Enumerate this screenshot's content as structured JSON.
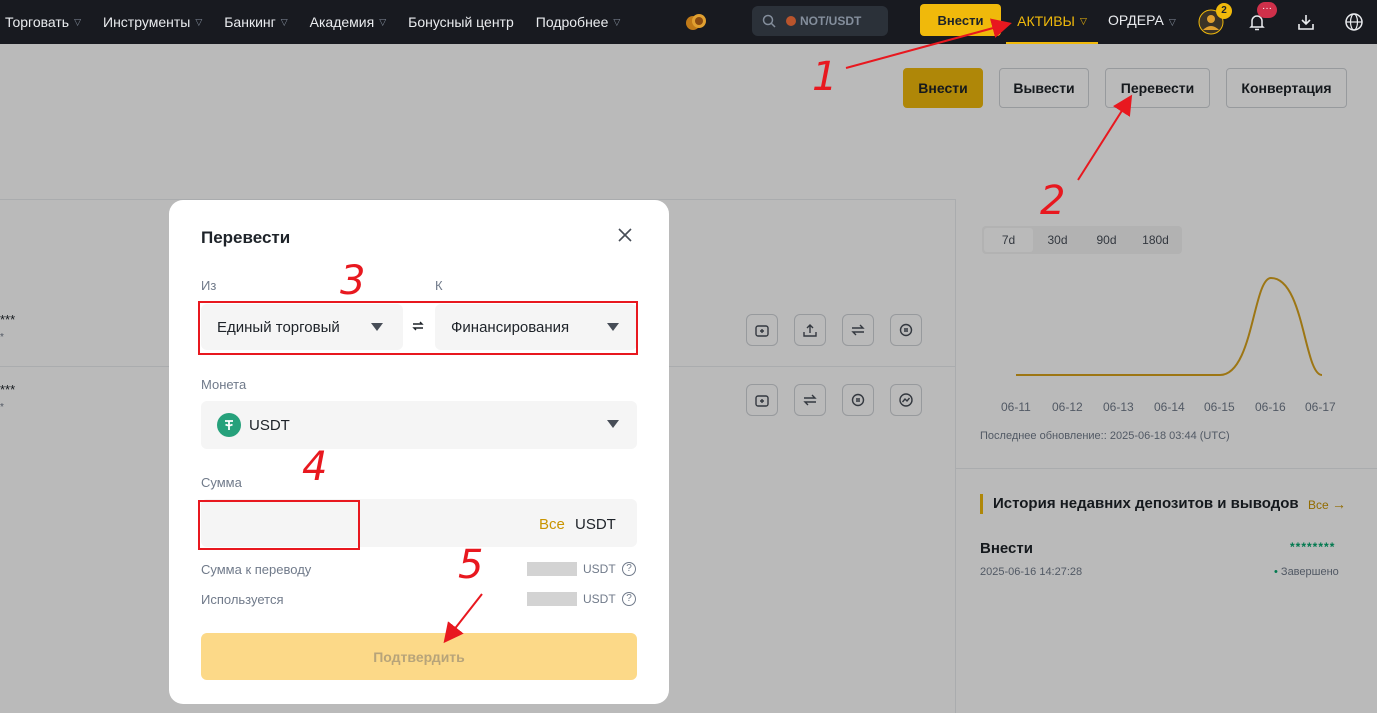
{
  "nav": {
    "items": [
      {
        "label": "Торговать",
        "chevron": true
      },
      {
        "label": "Инструменты",
        "chevron": true
      },
      {
        "label": "Банкинг",
        "chevron": true
      },
      {
        "label": "Академия",
        "chevron": true
      },
      {
        "label": "Бонусный центр",
        "chevron": false
      },
      {
        "label": "Подробнее",
        "chevron": true
      }
    ],
    "search_text": "NOT/USDT",
    "deposit_label": "Внести",
    "assets_label": "АКТИВЫ",
    "orders_label": "ОРДЕРА",
    "avatar_badge": "2",
    "notif_badge": "···"
  },
  "page": {
    "buttons": {
      "deposit": "Внести",
      "withdraw": "Вывести",
      "transfer": "Перевести",
      "convert": "Конвертация"
    },
    "rows": [
      {
        "stars": "***",
        "sub": "*"
      },
      {
        "stars": "***",
        "sub": "*"
      }
    ],
    "period_tabs": [
      "7d",
      "30d",
      "90d",
      "180d"
    ],
    "chart_ticks": [
      "06-11",
      "06-12",
      "06-13",
      "06-14",
      "06-15",
      "06-16",
      "06-17"
    ],
    "last_update": "Последнее обновление:: 2025-06-18 03:44 (UTC)",
    "history": {
      "title": "История недавних депозитов и выводов",
      "all_label": "Все",
      "item_label": "Внести",
      "item_amount": "********",
      "item_date": "2025-06-16 14:27:28",
      "item_status": "Завершено"
    }
  },
  "modal": {
    "title": "Перевести",
    "from_label": "Из",
    "to_label": "К",
    "from_value": "Единый торговый",
    "to_value": "Финансирования",
    "coin_label": "Монета",
    "coin_value": "USDT",
    "amount_label": "Сумма",
    "amount_all": "Все",
    "amount_unit": "USDT",
    "transfer_sum_label": "Сумма к переводу",
    "used_label": "Используется",
    "info_unit": "USDT",
    "confirm_label": "Подтвердить"
  },
  "annotations": {
    "numbers": [
      "1",
      "2",
      "3",
      "4",
      "5"
    ],
    "color": "#e8181f"
  },
  "colors": {
    "accent": "#f0b90b",
    "nav_bg": "#181a20",
    "success": "#03a66d"
  },
  "chart_data": {
    "type": "line",
    "x": [
      "06-11",
      "06-12",
      "06-13",
      "06-14",
      "06-15",
      "06-16",
      "06-17"
    ],
    "series": [
      {
        "values": [
          0,
          0,
          0,
          0,
          0,
          1,
          0
        ]
      }
    ],
    "title": "",
    "xlabel": "",
    "ylabel": ""
  }
}
